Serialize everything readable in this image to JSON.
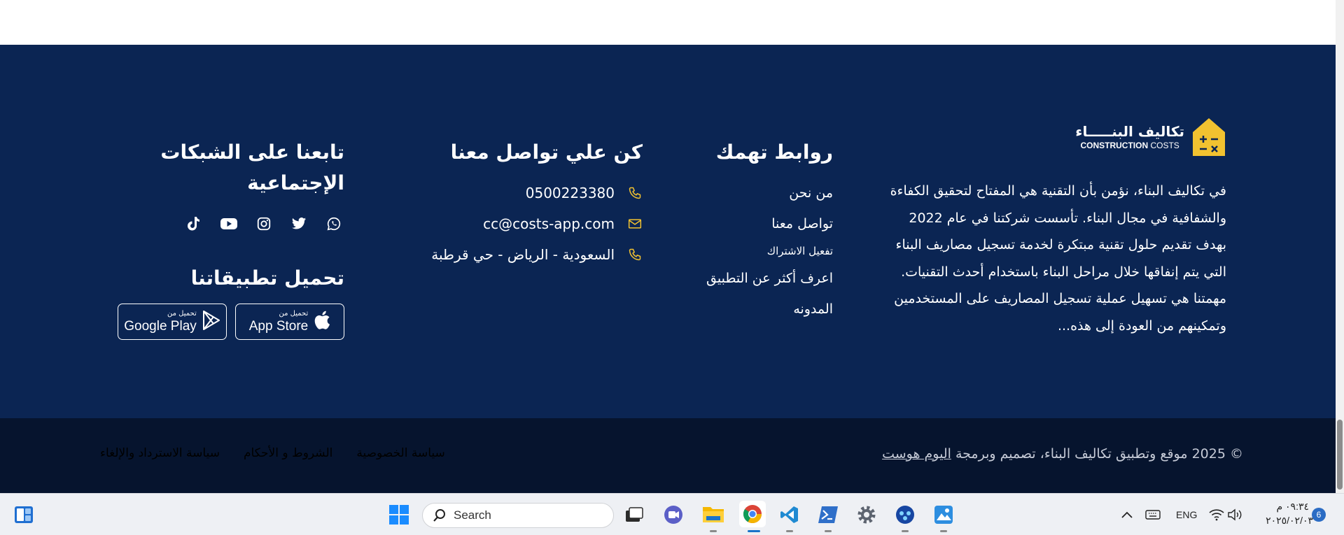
{
  "colors": {
    "footer_bg": "#0b2553",
    "bottom_bg": "#06142e",
    "accent": "#f2c230",
    "text": "#ffffff"
  },
  "about": {
    "logo_ar": "تكاليف البنـــــاء",
    "logo_en_bold": "CONSTRUCTION",
    "logo_en_light": "COSTS",
    "text": "في تكاليف البناء، نؤمن بأن التقنية هي المفتاح لتحقيق الكفاءة والشفافية في مجال البناء. تأسست شركتنا في عام 2022 بهدف تقديم حلول تقنية مبتكرة لخدمة تسجيل مصاريف البناء التي يتم إنفاقها خلال مراحل البناء باستخدام أحدث التقنيات. مهمتنا هي تسهيل عملية تسجيل المصاريف على المستخدمين وتمكينهم من العودة إلى هذه..."
  },
  "links": {
    "title": "روابط تهمك",
    "items": [
      "من نحن",
      "تواصل معنا",
      "تفعيل الاشتراك",
      "اعرف أكثر عن التطبيق",
      "المدونه"
    ]
  },
  "contact": {
    "title": "كن علي تواصل معنا",
    "phone": "0500223380",
    "email": "cc@costs-app.com",
    "address": "السعودية - الرياض - حي قرطبة"
  },
  "social": {
    "title": "تابعنا على الشبكات الإجتماعية",
    "icons": [
      "whatsapp-icon",
      "twitter-icon",
      "instagram-icon",
      "youtube-icon",
      "tiktok-icon"
    ],
    "apps_title": "تحميل تطبيقاتنا",
    "app_store": {
      "small": "تحميل من",
      "big": "App Store"
    },
    "google_play": {
      "small": "تحميل من",
      "big": "Google Play"
    }
  },
  "bottom": {
    "copyright_prefix": "© 2025 موقع وتطبيق تكاليف البناء، تصميم وبرمجة",
    "copyright_brand": "اليوم هوست",
    "policies": [
      "سياسة الخصوصية",
      "الشروط و الأحكام",
      "سياسة الاسترداد والإلغاء"
    ]
  },
  "taskbar": {
    "search_placeholder": "Search",
    "language": "ENG",
    "time": "٠٩:٣٤ م",
    "date": "٢٠٢٥/٠٢/٠٣",
    "notification_count": "6"
  }
}
